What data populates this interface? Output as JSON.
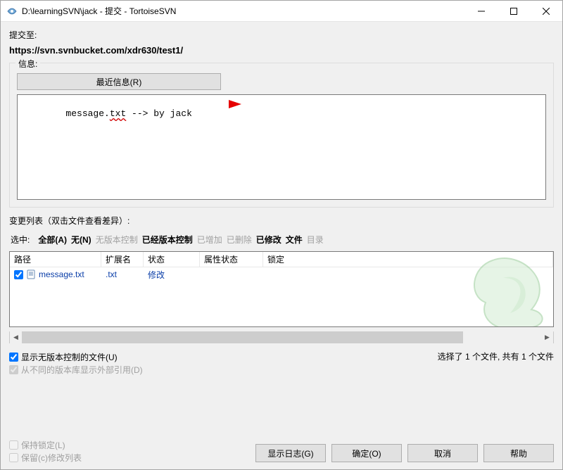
{
  "window": {
    "title": "D:\\learningSVN\\jack - 提交 - TortoiseSVN"
  },
  "commit_to_label": "提交至:",
  "commit_url": "https://svn.svnbucket.com/xdr630/test1/",
  "info": {
    "legend": "信息:",
    "recent_button": "最近信息(R)",
    "message_prefix": "message.",
    "message_underlined": "txt",
    "message_suffix": " --> by jack"
  },
  "changes_label": "变更列表（双击文件查看差异）:",
  "filters": {
    "lead": "选中:",
    "all": "全部(A)",
    "none": "无(N)",
    "unversioned": "无版本控制",
    "versioned": "已经版本控制",
    "added": "已增加",
    "deleted": "已删除",
    "modified": "已修改",
    "file": "文件",
    "dir": "目录"
  },
  "list": {
    "headers": {
      "path": "路径",
      "ext": "扩展名",
      "status": "状态",
      "prop": "属性状态",
      "lock": "锁定"
    },
    "rows": [
      {
        "checked": true,
        "path": "message.txt",
        "ext": ".txt",
        "status": "修改",
        "prop": "",
        "lock": ""
      }
    ]
  },
  "show_unversioned": "显示无版本控制的文件(U)",
  "show_externals": "从不同的版本库显示外部引用(D)",
  "selection_status": "选择了 1 个文件, 共有 1 个文件",
  "keep_lock": "保持锁定(L)",
  "keep_changelist": "保留(c)修改列表",
  "buttons": {
    "showlog": "显示日志(G)",
    "ok": "确定(O)",
    "cancel": "取消",
    "help": "帮助"
  }
}
